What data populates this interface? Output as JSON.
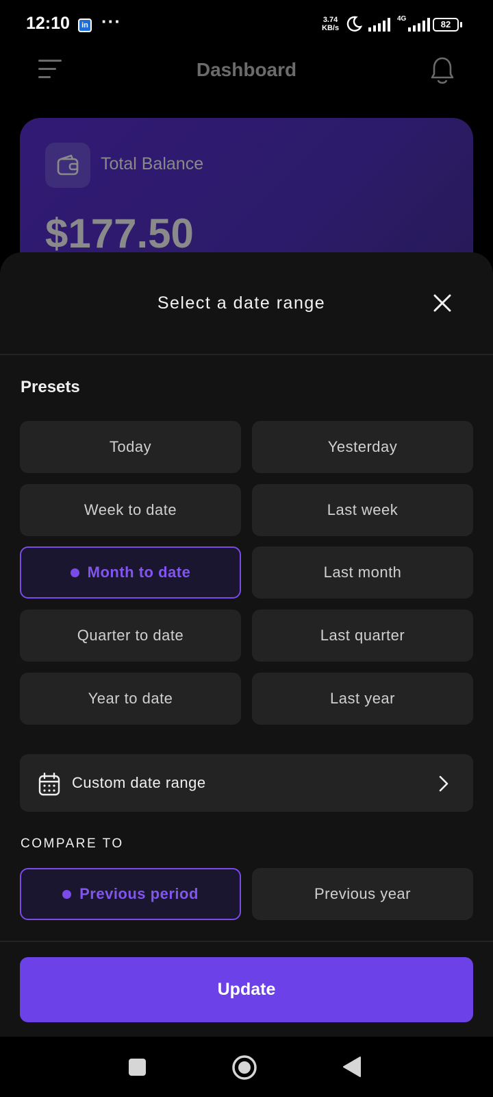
{
  "status_bar": {
    "time": "12:10",
    "app_badge": "in",
    "more": "···",
    "net_speed_value": "3.74",
    "net_speed_unit": "KB/s",
    "network_type": "4G",
    "battery": "82"
  },
  "header": {
    "title": "Dashboard",
    "menu_icon": "hamburger-menu-icon",
    "notification_icon": "bell-icon"
  },
  "balance_card": {
    "label": "Total Balance",
    "amount": "$177.50",
    "icon": "wallet-icon"
  },
  "sheet": {
    "title": "Select a date range",
    "presets_heading": "Presets",
    "presets": [
      {
        "label": "Today",
        "selected": false
      },
      {
        "label": "Yesterday",
        "selected": false
      },
      {
        "label": "Week to date",
        "selected": false
      },
      {
        "label": "Last week",
        "selected": false
      },
      {
        "label": "Month to date",
        "selected": true
      },
      {
        "label": "Last month",
        "selected": false
      },
      {
        "label": "Quarter to date",
        "selected": false
      },
      {
        "label": "Last quarter",
        "selected": false
      },
      {
        "label": "Year to date",
        "selected": false
      },
      {
        "label": "Last year",
        "selected": false
      }
    ],
    "custom_range_label": "Custom date range",
    "compare_heading": "COMPARE TO",
    "compare_options": [
      {
        "label": "Previous period",
        "selected": true
      },
      {
        "label": "Previous year",
        "selected": false
      }
    ],
    "update_label": "Update"
  },
  "colors": {
    "accent": "#6c42e8",
    "selected_text": "#8155ee",
    "card_gradient_start": "#311a75",
    "sheet_background": "#131313",
    "button_background": "#232323"
  }
}
